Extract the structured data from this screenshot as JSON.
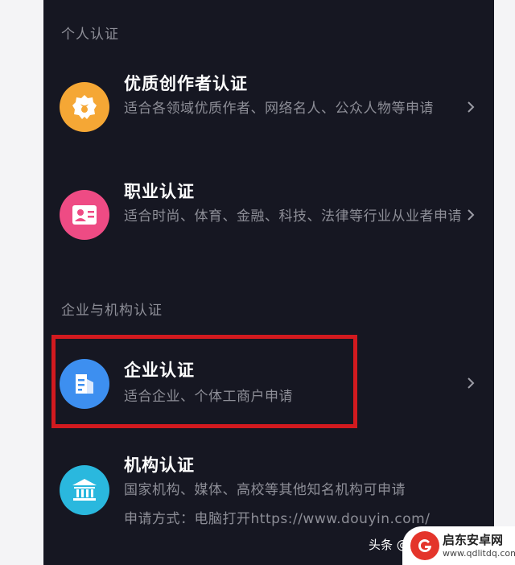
{
  "sections": {
    "personal": {
      "title": "个人认证"
    },
    "enterprise": {
      "title": "企业与机构认证"
    }
  },
  "items": {
    "quality_creator": {
      "title": "优质创作者认证",
      "desc": "适合各领域优质作者、网络名人、公众人物等申请",
      "icon": "badge-icon",
      "color": "#f5a735"
    },
    "profession": {
      "title": "职业认证",
      "desc": "适合时尚、体育、金融、科技、法律等行业从业者申请",
      "icon": "id-card-icon",
      "color": "#ee4b84"
    },
    "enterprise": {
      "title": "企业认证",
      "desc": "适合企业、个体工商户申请",
      "icon": "building-icon",
      "color": "#3d8ff0"
    },
    "institution": {
      "title": "机构认证",
      "desc": "国家机构、媒体、高校等其他知名机构可申请",
      "desc2": "申请方式：电脑打开https://www.douyin.com/",
      "icon": "institution-icon",
      "color": "#2ab8de"
    }
  },
  "watermark": {
    "source": "头条 @",
    "logo_text": "启东安卓网",
    "logo_url": "www.qdlitdq.com"
  },
  "colors": {
    "background": "#161722",
    "highlight": "#d21a1f"
  }
}
